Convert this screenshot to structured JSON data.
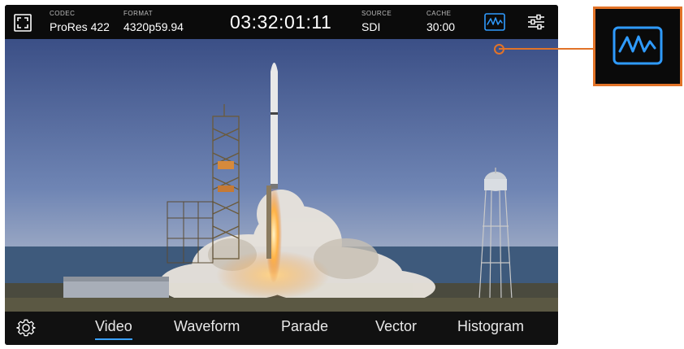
{
  "status": {
    "codec": {
      "label": "CODEC",
      "value": "ProRes 422"
    },
    "format": {
      "label": "FORMAT",
      "value": "4320p59.94"
    },
    "timecode": "03:32:01:11",
    "source": {
      "label": "SOURCE",
      "value": "SDI"
    },
    "cache": {
      "label": "CACHE",
      "value": "30:00"
    }
  },
  "tabs": [
    {
      "label": "Video",
      "active": true
    },
    {
      "label": "Waveform",
      "active": false
    },
    {
      "label": "Parade",
      "active": false
    },
    {
      "label": "Vector",
      "active": false
    },
    {
      "label": "Histogram",
      "active": false
    }
  ],
  "icons": {
    "fullscreen": "fullscreen-icon",
    "scope": "waveform-scope-icon",
    "sliders": "sliders-settings-icon",
    "gear": "gear-icon"
  },
  "colors": {
    "accent_blue": "#2f9bff",
    "callout_orange": "#e27328"
  }
}
